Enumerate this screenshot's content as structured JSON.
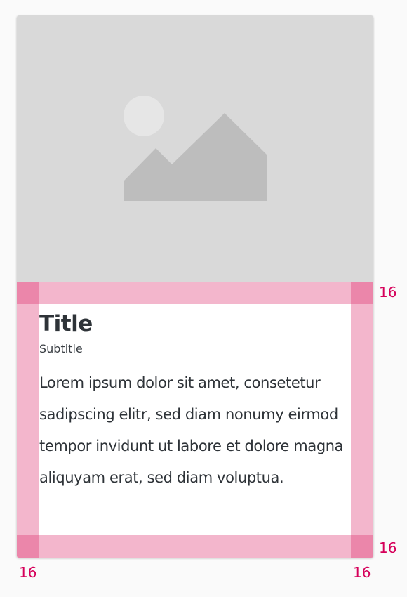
{
  "card": {
    "title": "Title",
    "subtitle": "Subtitle",
    "body": "Lorem ipsum dolor sit amet, consetetur sadipscing elitr, sed diam nonumy eirmod tempor invidunt ut labore et dolore magna aliquyam erat, sed diam voluptua.",
    "media_icon": "image-placeholder-icon"
  },
  "annotations": {
    "padding_top": "16",
    "padding_bottom": "16",
    "padding_left": "16",
    "padding_right": "16"
  },
  "colors": {
    "background": "#fafafa",
    "media": "#d9d9d9",
    "media_shapes": "#bdbdbd",
    "media_sun": "#e6e6e6",
    "padding_overlay": "#f3b6cc",
    "padding_corner": "#eb86aa",
    "annotation_text": "#d6005a",
    "text_primary": "#2e3338"
  }
}
